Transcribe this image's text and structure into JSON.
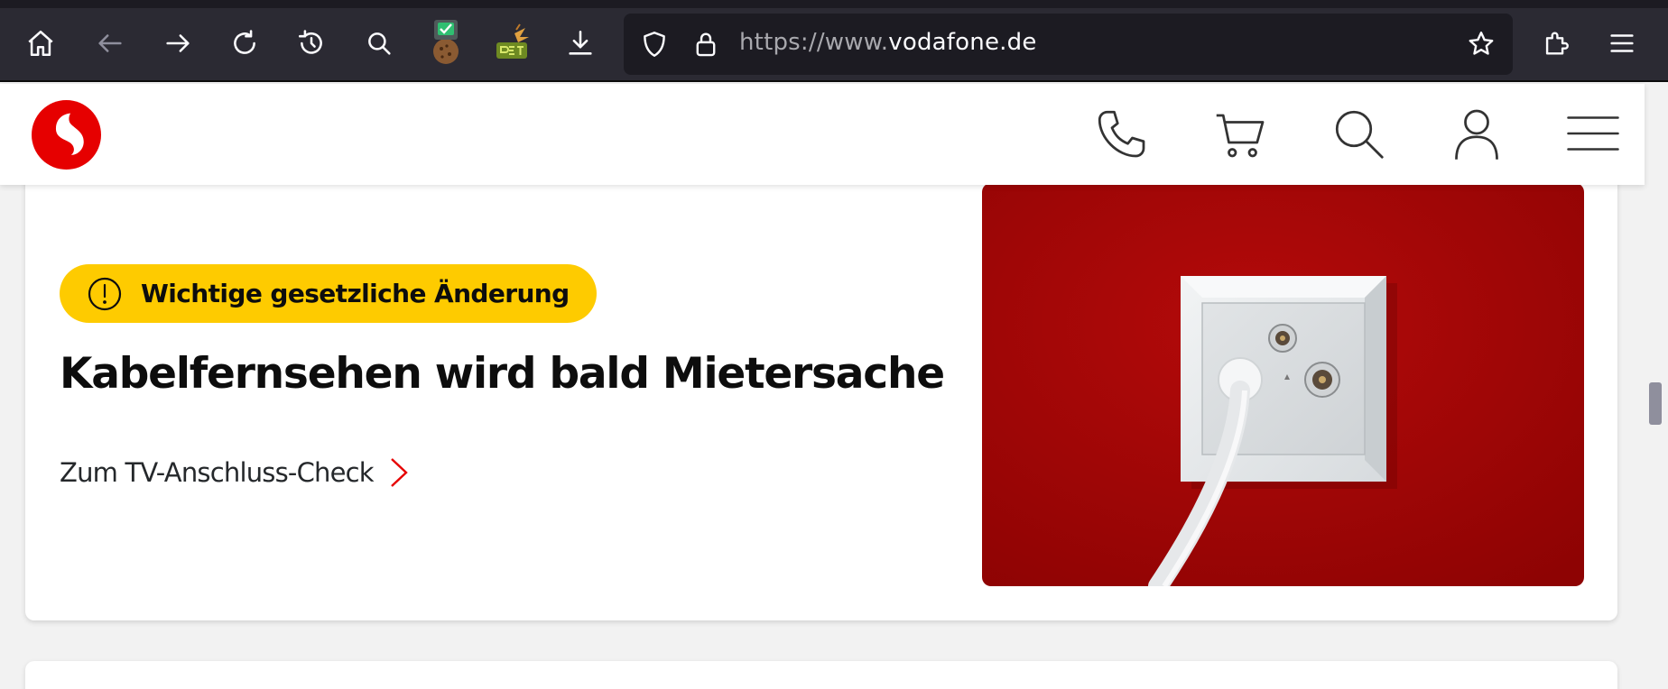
{
  "browser": {
    "url_prefix": "https://www.",
    "url_domain": "vodafone.de",
    "toolbar_icons": [
      "home-icon",
      "back-icon",
      "forward-icon",
      "reload-icon",
      "history-icon",
      "search-icon",
      "cookie-extension-icon",
      "pet-extension-icon",
      "download-icon"
    ],
    "url_icons": [
      "shield-icon",
      "lock-icon",
      "bookmark-star-icon"
    ],
    "right_icons": [
      "extensions-icon",
      "app-menu-icon"
    ]
  },
  "header": {
    "logo": "vodafone-logo",
    "icons": [
      "phone-icon",
      "cart-icon",
      "search-icon",
      "user-icon",
      "menu-icon"
    ]
  },
  "teaser": {
    "badge": "Wichtige gesetzliche Änderung",
    "headline": "Kabelfernsehen wird bald Mietersache",
    "cta": "Zum TV-Anschluss-Check"
  },
  "colors": {
    "brand_red": "#e60000",
    "badge_yellow": "#fecb00",
    "hero_red": "#a80606",
    "chrome_dark": "#2b2a33"
  }
}
